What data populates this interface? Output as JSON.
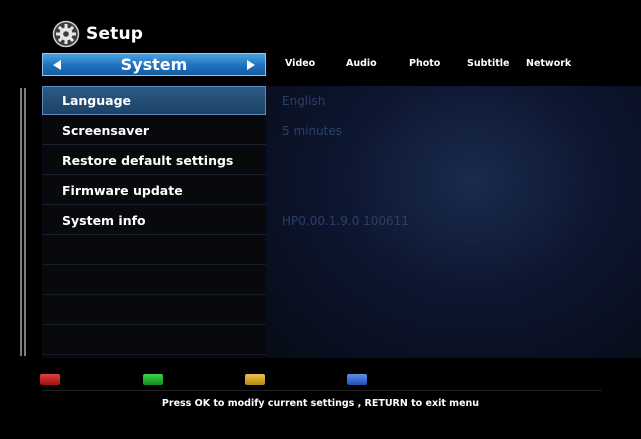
{
  "header": {
    "title": "Setup",
    "icon": "gear-icon"
  },
  "category": {
    "current": "System",
    "prev_icon": "arrow-left-icon",
    "next_icon": "arrow-right-icon"
  },
  "tabs": [
    {
      "label": "Video"
    },
    {
      "label": "Audio"
    },
    {
      "label": "Photo"
    },
    {
      "label": "Subtitle"
    },
    {
      "label": "Network"
    }
  ],
  "menu": {
    "items": [
      {
        "label": "Language",
        "value": "English",
        "selected": true
      },
      {
        "label": "Screensaver",
        "value": "5 minutes"
      },
      {
        "label": "Restore default settings",
        "value": ""
      },
      {
        "label": "Firmware update",
        "value": ""
      },
      {
        "label": "System info",
        "value": "HP0.00.1.9.0 100611"
      }
    ]
  },
  "color_buttons": [
    {
      "name": "red-button",
      "color": "#c81e1e"
    },
    {
      "name": "green-button",
      "color": "#22b02c"
    },
    {
      "name": "yellow-button",
      "color": "#d6a82a"
    },
    {
      "name": "blue-button",
      "color": "#3a6fd6"
    }
  ],
  "colors": {
    "accent": "#1e70bd",
    "selected_row": "#2c5a86",
    "value_text": "#29406a"
  },
  "footer": {
    "hint": "Press OK to modify current settings ,  RETURN to exit menu"
  }
}
